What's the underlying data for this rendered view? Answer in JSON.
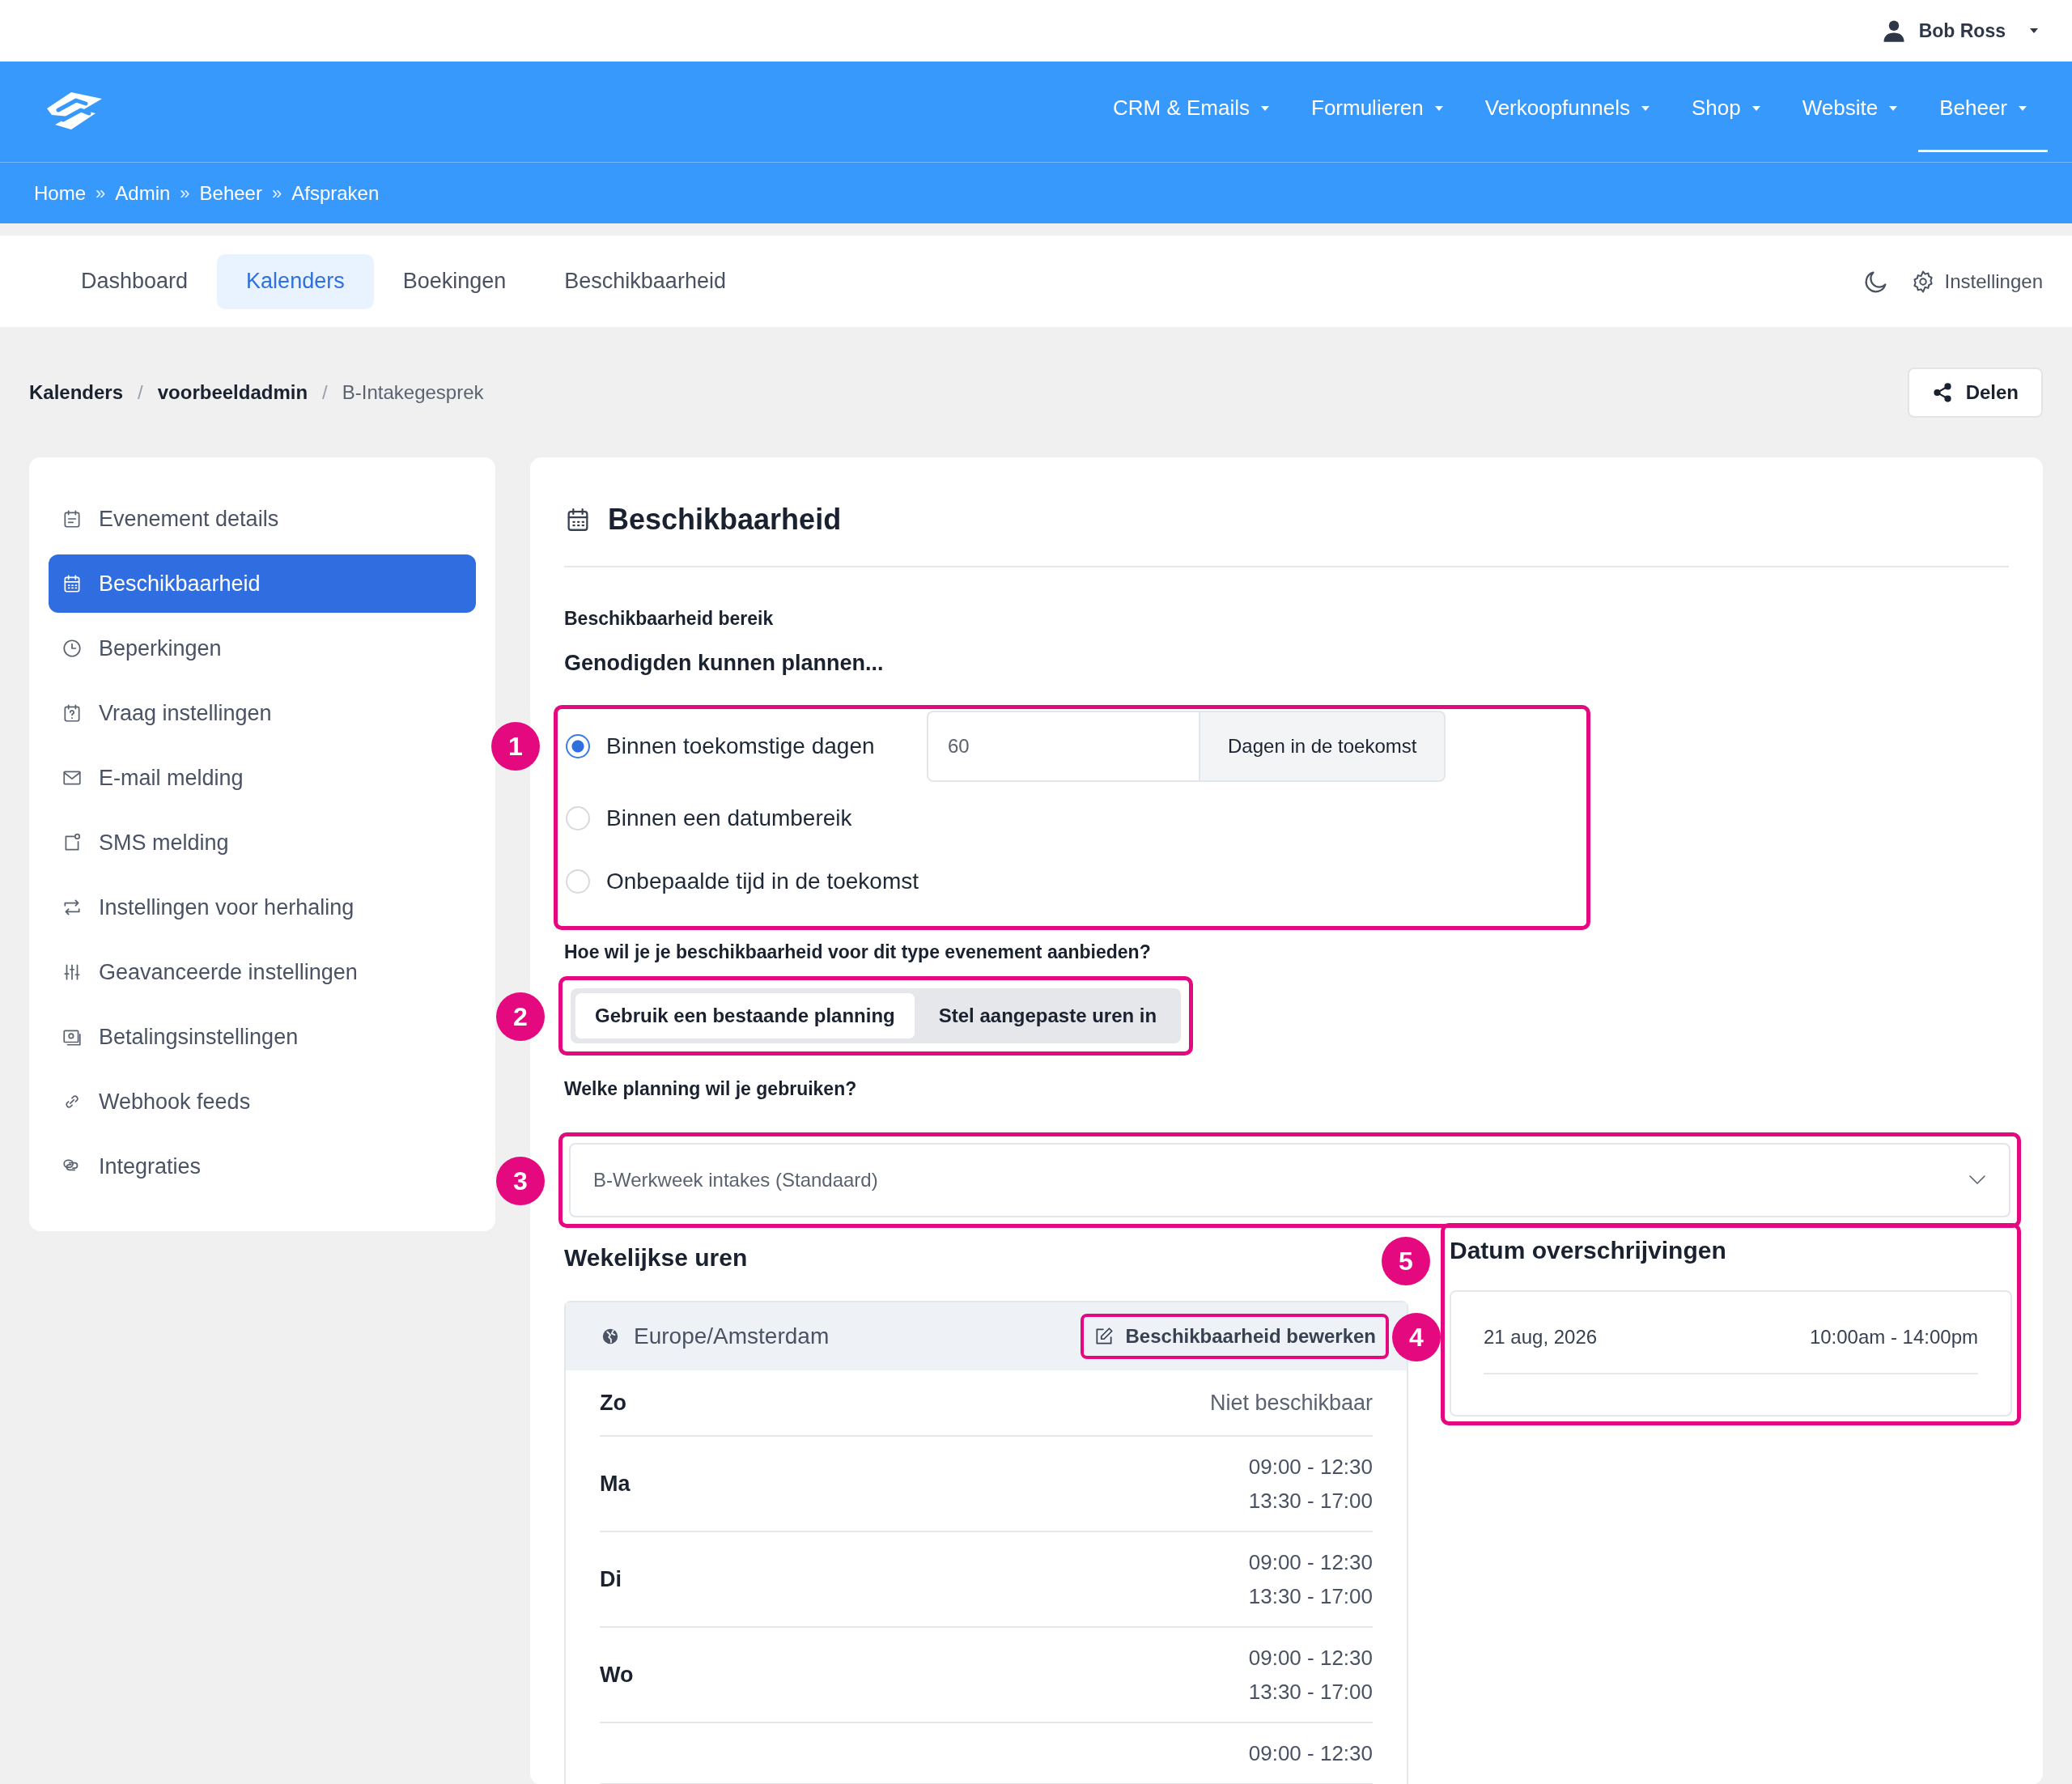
{
  "user_menu": {
    "name": "Bob Ross"
  },
  "nav": [
    {
      "label": "CRM & Emails",
      "selected": false
    },
    {
      "label": "Formulieren",
      "selected": false
    },
    {
      "label": "Verkoopfunnels",
      "selected": false
    },
    {
      "label": "Shop",
      "selected": false
    },
    {
      "label": "Website",
      "selected": false
    },
    {
      "label": "Beheer",
      "selected": true
    }
  ],
  "location_bar": {
    "separator": "»",
    "items": [
      "Home",
      "Admin",
      "Beheer",
      "Afspraken"
    ]
  },
  "tabs": [
    {
      "label": "Dashboard",
      "selected": false
    },
    {
      "label": "Kalenders",
      "selected": true
    },
    {
      "label": "Boekingen",
      "selected": false
    },
    {
      "label": "Beschikbaarheid",
      "selected": false
    }
  ],
  "settings_link": "Instellingen",
  "breadcrumb": {
    "separator": "/",
    "items": [
      {
        "label": "Kalenders",
        "current": false
      },
      {
        "label": "voorbeeldadmin",
        "current": false
      },
      {
        "label": "B-Intakegesprek",
        "current": true
      }
    ]
  },
  "share_button": "Delen",
  "sidebar": {
    "items": [
      {
        "label": "Evenement details",
        "selected": false
      },
      {
        "label": "Beschikbaarheid",
        "selected": true
      },
      {
        "label": "Beperkingen",
        "selected": false
      },
      {
        "label": "Vraag instellingen",
        "selected": false
      },
      {
        "label": "E-mail melding",
        "selected": false
      },
      {
        "label": "SMS melding",
        "selected": false
      },
      {
        "label": "Instellingen voor herhaling",
        "selected": false
      },
      {
        "label": "Geavanceerde instellingen",
        "selected": false
      },
      {
        "label": "Betalingsinstellingen",
        "selected": false
      },
      {
        "label": "Webhook feeds",
        "selected": false
      },
      {
        "label": "Integraties",
        "selected": false
      }
    ]
  },
  "panel": {
    "title": "Beschikbaarheid",
    "range": {
      "label": "Beschikbaarheid bereik",
      "heading": "Genodigden kunnen plannen...",
      "callout": "1",
      "options": [
        {
          "label": "Binnen toekomstige dagen",
          "selected": true,
          "kind": "days"
        },
        {
          "label": "Binnen een datumbereik",
          "selected": false,
          "kind": "plain"
        },
        {
          "label": "Onbepaalde tijd in de toekomst",
          "selected": false,
          "kind": "plain"
        }
      ],
      "days_field": {
        "value": "60",
        "addon": "Dagen in de toekomst"
      }
    },
    "mode": {
      "label": "Hoe wil je je beschikbaarheid voor dit type evenement aanbieden?",
      "callout": "2",
      "options": [
        {
          "label": "Gebruik een bestaande planning",
          "selected": true
        },
        {
          "label": "Stel aangepaste uren in",
          "selected": false
        }
      ]
    },
    "schedule": {
      "label": "Welke planning wil je gebruiken?",
      "callout": "3",
      "value": "B-Werkweek intakes (Standaard)"
    },
    "weekly": {
      "title": "Wekelijkse uren",
      "timezone": "Europe/Amsterdam",
      "edit_button": "Beschikbaarheid bewerken",
      "edit_callout": "4",
      "rows": [
        {
          "day": "Zo",
          "kind": "unavailable",
          "times": [
            "Niet beschikbaar"
          ]
        },
        {
          "day": "Ma",
          "kind": "hours",
          "times": [
            "09:00 - 12:30",
            "13:30 - 17:00"
          ]
        },
        {
          "day": "Di",
          "kind": "hours",
          "times": [
            "09:00 - 12:30",
            "13:30 - 17:00"
          ]
        },
        {
          "day": "Wo",
          "kind": "hours",
          "times": [
            "09:00 - 12:30",
            "13:30 - 17:00"
          ]
        },
        {
          "kind": "hours",
          "times": [
            "09:00 - 12:30"
          ]
        }
      ]
    },
    "overrides": {
      "title": "Datum overschrijvingen",
      "callout": "5",
      "rows": [
        {
          "date": "21 aug, 2026",
          "time": "10:00am - 14:00pm"
        }
      ]
    }
  }
}
